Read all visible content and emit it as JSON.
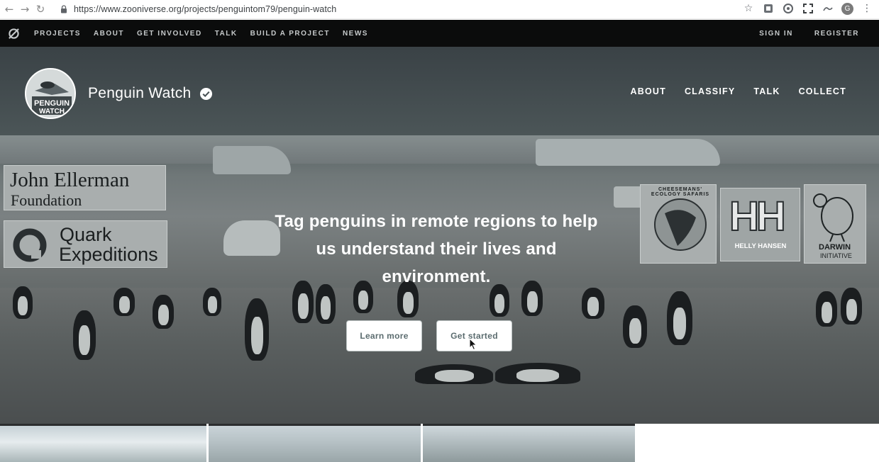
{
  "browser": {
    "url": "https://www.zooniverse.org/projects/penguintom79/penguin-watch",
    "back_glyph": "←",
    "forward_glyph": "→",
    "reload_glyph": "↻",
    "avatar_letter": "G",
    "icons": [
      "star-icon",
      "extension-icon",
      "sync-icon",
      "screenshot-icon",
      "pen-icon",
      "profile-avatar",
      "kebab-menu-icon"
    ]
  },
  "zoo_nav": {
    "links": [
      "PROJECTS",
      "ABOUT",
      "GET INVOLVED",
      "TALK",
      "BUILD A PROJECT",
      "NEWS"
    ],
    "sign_in": "SIGN IN",
    "register": "REGISTER"
  },
  "project": {
    "title": "Penguin Watch",
    "avatar_text": "PENGUIN WATCH",
    "nav": [
      "ABOUT",
      "CLASSIFY",
      "TALK",
      "COLLECT"
    ]
  },
  "sponsors": {
    "left_top": [
      "John Ellerman",
      "Foundation"
    ],
    "left_bottom": [
      "Quark",
      "Expeditions"
    ],
    "right_1": "CHEESEMANS' ECOLOGY SAFARIS",
    "right_2": "HELLY HANSEN",
    "right_2_logo": "HH",
    "right_3": [
      "DARWIN",
      "INITIATIVE"
    ]
  },
  "hero": {
    "tagline": "Tag penguins in remote regions to help us understand their lives and environment.",
    "learn_more": "Learn more",
    "get_started": "Get started"
  },
  "colors": {
    "nav_bg": "#0b0c0c",
    "nav_text": "#c6cacb",
    "button_text": "#5b6c6f"
  }
}
